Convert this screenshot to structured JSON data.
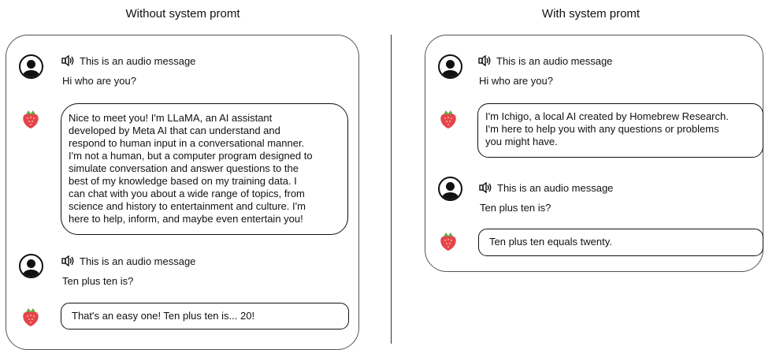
{
  "panels": [
    {
      "title": "Without system promt",
      "conversation": [
        {
          "role": "user",
          "audio_label": "This is an audio message",
          "text": "Hi who are you?"
        },
        {
          "role": "assistant",
          "lines": [
            "Nice to meet you! I'm LLaMA, an AI assistant",
            "developed by Meta AI that can understand and",
            "respond to human input in a conversational manner.",
            "I'm not a human, but a computer program designed to",
            "simulate conversation and answer questions to the",
            "best of my knowledge based on my training data. I",
            "can chat with you about a wide range of topics, from",
            "science and history to entertainment and culture. I'm",
            "here to help, inform, and maybe even entertain you!"
          ]
        },
        {
          "role": "user",
          "audio_label": "This is an audio message",
          "text": "Ten plus ten is?"
        },
        {
          "role": "assistant",
          "lines": [
            "That's an easy one! Ten plus ten is... 20!"
          ]
        }
      ]
    },
    {
      "title": "With system promt",
      "conversation": [
        {
          "role": "user",
          "audio_label": "This is an audio message",
          "text": "Hi who are you?"
        },
        {
          "role": "assistant",
          "lines": [
            "I'm Ichigo, a local AI created by Homebrew Research.",
            "I'm here to help you with any questions or problems",
            "you might have."
          ]
        },
        {
          "role": "user",
          "audio_label": "This is an audio message",
          "text": "Ten plus ten is?"
        },
        {
          "role": "assistant",
          "lines": [
            "Ten plus ten equals twenty."
          ]
        }
      ]
    }
  ],
  "icons": {
    "user": "user-avatar-icon",
    "assistant": "strawberry-icon",
    "audio": "speaker-icon"
  }
}
